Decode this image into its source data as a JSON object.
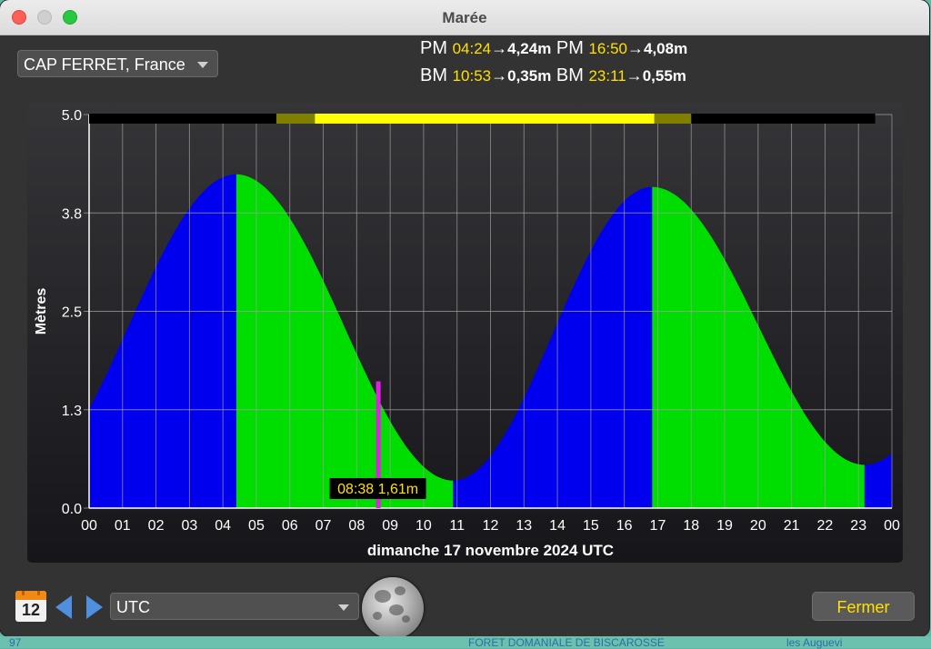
{
  "window": {
    "title": "Marée"
  },
  "location": {
    "selected": "CAP FERRET, France"
  },
  "tides": [
    {
      "type": "PM",
      "time": "04:24",
      "arrow": "→",
      "height": "4,24m"
    },
    {
      "type": "PM",
      "time": "16:50",
      "arrow": "→",
      "height": "4,08m"
    },
    {
      "type": "BM",
      "time": "10:53",
      "arrow": "→",
      "height": "0,35m"
    },
    {
      "type": "BM",
      "time": "23:11",
      "arrow": "→",
      "height": "0,55m"
    }
  ],
  "chart_data": {
    "type": "area",
    "ylabel": "Mètres",
    "xlabel": "dimanche 17 novembre 2024 UTC",
    "ylim": [
      0,
      5
    ],
    "yticks": [
      "0.0",
      "1.3",
      "2.5",
      "3.8",
      "5.0"
    ],
    "ytick_values": [
      0,
      1.25,
      2.5,
      3.75,
      5
    ],
    "xticks": [
      "00",
      "01",
      "02",
      "03",
      "04",
      "05",
      "06",
      "07",
      "08",
      "09",
      "10",
      "11",
      "12",
      "13",
      "14",
      "15",
      "16",
      "17",
      "18",
      "19",
      "20",
      "21",
      "22",
      "23",
      "00"
    ],
    "xlim_hours": [
      0,
      24
    ],
    "extrema": [
      {
        "t": 4.4,
        "h": 4.24
      },
      {
        "t": 10.883,
        "h": 0.35
      },
      {
        "t": 16.833,
        "h": 4.08
      },
      {
        "t": 23.183,
        "h": 0.55
      }
    ],
    "start_height": 1.1,
    "end_height": 0.75,
    "rising_color": "#0000ee",
    "falling_color": "#00dd00",
    "current": {
      "t": 8.633,
      "h": 1.61,
      "label": "08:38 1,61m",
      "color": "#e020e0"
    },
    "grid": true,
    "daylight_bar": [
      {
        "from": 0,
        "to": 5.6,
        "color": "#000000"
      },
      {
        "from": 5.6,
        "to": 6.75,
        "color": "#808000"
      },
      {
        "from": 6.75,
        "to": 16.9,
        "color": "#ffff00"
      },
      {
        "from": 16.9,
        "to": 18.0,
        "color": "#808000"
      },
      {
        "from": 18.0,
        "to": 23.5,
        "color": "#000000"
      }
    ]
  },
  "calendar": {
    "day": "12"
  },
  "timezone": {
    "selected": "UTC"
  },
  "buttons": {
    "close": "Fermer"
  },
  "desktop": {
    "left_text": "97",
    "mid_text": "FORET DOMANIALE DE BISCAROSSE",
    "right_text": "les Auguevi"
  }
}
